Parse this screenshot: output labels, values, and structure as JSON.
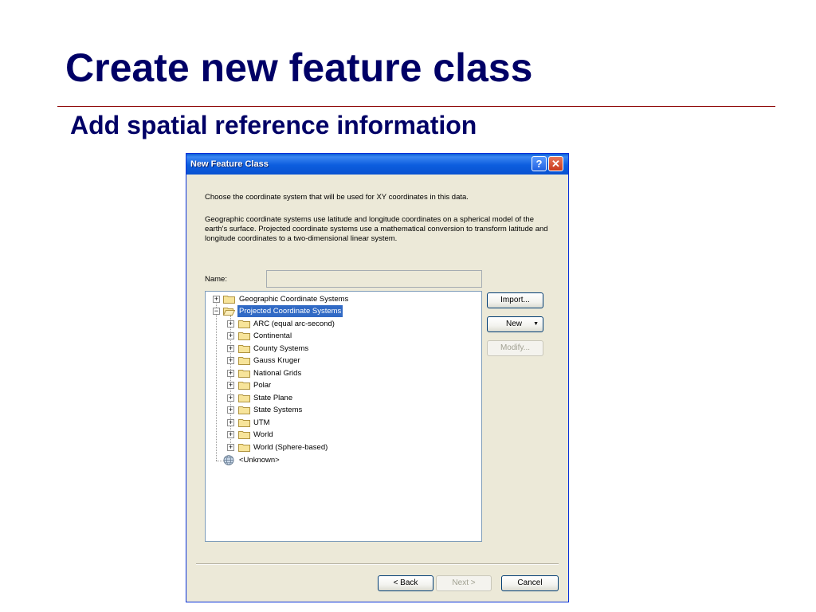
{
  "slide": {
    "title": "Create new feature class",
    "subtitle": "Add spatial reference information"
  },
  "dialog": {
    "title": "New Feature Class",
    "help_label": "?",
    "close_label": "✕",
    "paragraph1": "Choose the coordinate system that will be used for XY coordinates in this data.",
    "paragraph2": "Geographic coordinate systems use latitude and longitude coordinates on a spherical model of the earth's surface. Projected coordinate systems use a mathematical conversion to transform latitude and longitude coordinates to a two-dimensional linear system.",
    "name_label": "Name:",
    "name_value": "",
    "tree": {
      "geographic": "Geographic Coordinate Systems",
      "projected": "Projected Coordinate Systems",
      "children": [
        "ARC (equal arc-second)",
        "Continental",
        "County Systems",
        "Gauss Kruger",
        "National Grids",
        "Polar",
        "State Plane",
        "State Systems",
        "UTM",
        "World",
        "World (Sphere-based)"
      ],
      "unknown": "<Unknown>"
    },
    "buttons": {
      "import": "Import...",
      "new": "New",
      "new_arrow": "▼",
      "modify": "Modify...",
      "back": "< Back",
      "next": "Next >",
      "cancel": "Cancel"
    }
  }
}
